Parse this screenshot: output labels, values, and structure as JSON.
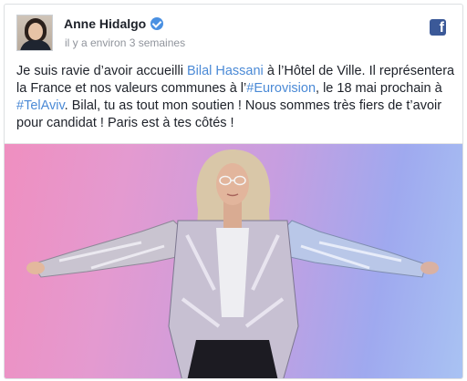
{
  "post": {
    "author": "Anne Hidalgo",
    "time": "il y a environ 3 semaines",
    "icons": {
      "avatar": "profile-photo",
      "verified": "verified-badge-icon",
      "platform": "facebook-icon"
    },
    "platform_glyph": "f",
    "text": {
      "seg1": "Je suis ravie d’avoir accueilli ",
      "link1": "Bilal Hassani",
      "seg2": " à l’Hôtel de Ville. Il représentera la France et nos valeurs communes à l’",
      "link2": "#Eurovision",
      "seg3": ", le 18 mai prochain à ",
      "link3": "#TelAviv",
      "seg4": ". Bilal, tu as tout mon soutien ! Nous sommes très fiers de t’avoir pour candidat ! Paris est à tes côtés !"
    }
  },
  "colors": {
    "link": "#4b8ad6",
    "facebook": "#3b5998",
    "verified": "#4a90e2",
    "photo_gradient": [
      "#ef8fc0",
      "#c79ee0",
      "#a9c3f3"
    ]
  }
}
